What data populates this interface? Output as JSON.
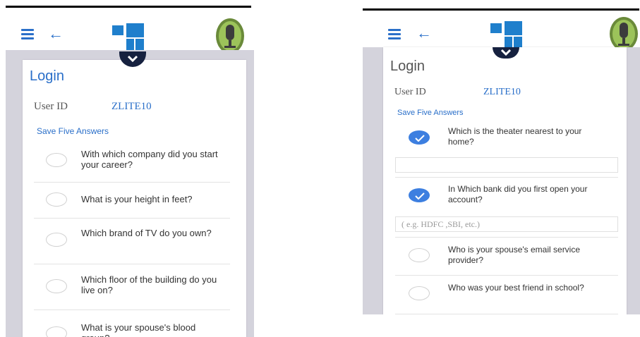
{
  "left": {
    "login_title": "Login",
    "user_id_label": "User ID",
    "user_id_value": "ZLITE10",
    "save_five": "Save Five Answers",
    "questions": [
      {
        "text": "With which company did you start your career?",
        "checked": false
      },
      {
        "text": "What is your height in feet?",
        "checked": false
      },
      {
        "text": "Which brand of TV do you own?",
        "checked": false
      },
      {
        "text": "Which floor of the building do you live on?",
        "checked": false
      },
      {
        "text": "What is your spouse's blood group?",
        "checked": false
      }
    ]
  },
  "right": {
    "login_title": "Login",
    "user_id_label": "User ID",
    "user_id_value": "ZLITE10",
    "save_five": "Save Five Answers",
    "questions": [
      {
        "text": "Which is the theater nearest to your home?",
        "checked": true,
        "answer_placeholder": ""
      },
      {
        "text": "In Which bank did you first open your account?",
        "checked": true,
        "answer_placeholder": "( e.g. HDFC ,SBI, etc.)"
      },
      {
        "text": "Who is your spouse's email service provider?",
        "checked": false
      },
      {
        "text": "Who was your best friend in school?",
        "checked": false
      }
    ]
  },
  "colors": {
    "accent": "#2a6fc9",
    "checked": "#3d7fe0",
    "background_gray": "#d4d3dc",
    "chevron": "#16213f"
  },
  "icons": {
    "menu": "hamburger-icon",
    "back": "arrow-left-icon",
    "logo": "brand-logo",
    "mic": "microphone-icon",
    "collapse": "chevron-down-icon",
    "check": "checkmark-icon"
  }
}
